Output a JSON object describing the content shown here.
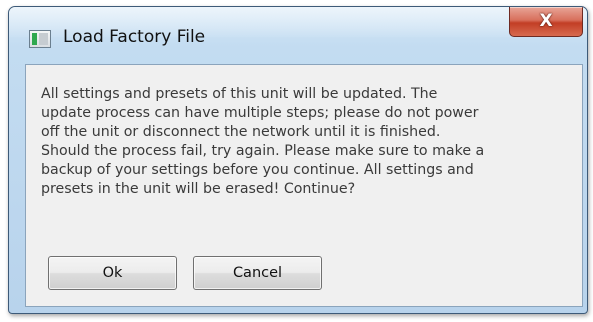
{
  "dialog": {
    "title": "Load Factory File",
    "close_label": "X",
    "app_icon": "application-icon",
    "message_lines": [
      "All settings and presets of this unit will be updated. The",
      "update process can have multiple steps; please do not power",
      "off the unit or disconnect the network until it is finished.",
      "Should the process fail, try again. Please make sure to make a",
      "backup of your settings before you continue. All settings and",
      "presets in the unit will be erased! Continue?"
    ],
    "buttons": {
      "ok_label": "Ok",
      "cancel_label": "Cancel"
    }
  },
  "colors": {
    "close_button": "#c23e25",
    "frame": "#c3dcf1",
    "client_background": "#f0f0f0"
  }
}
